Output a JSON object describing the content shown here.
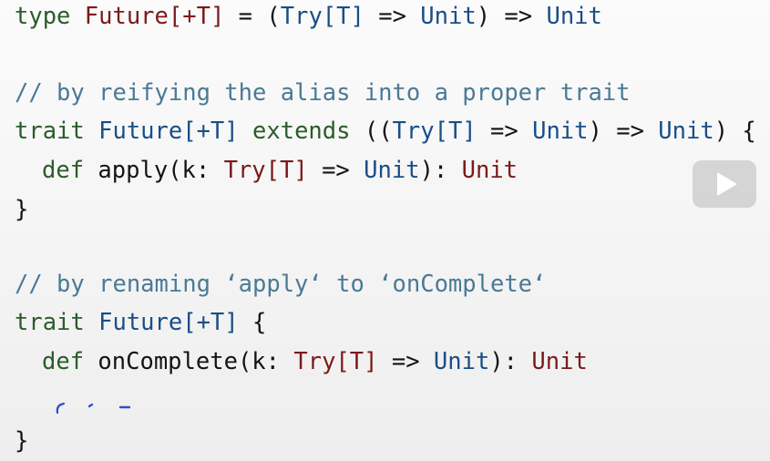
{
  "code": {
    "line1": {
      "kw": "type",
      "name": " Future[+T]",
      "eq": " = (",
      "t1": "Try[T]",
      "a1": " => ",
      "u1": "Unit",
      "close": ") => ",
      "u2": "Unit"
    },
    "line2": {
      "comment": "// by reifying the alias into a proper trait"
    },
    "line3": {
      "kw": "trait",
      "name": " Future[+T]",
      "ext": " extends",
      "open": " ((",
      "t1": "Try[T]",
      "a1": " => ",
      "u1": "Unit",
      "mid": ") => ",
      "u2": "Unit",
      "close": ") {"
    },
    "line4": {
      "kw": "def",
      "name": " apply(k: ",
      "t1": "Try[T]",
      "a1": " => ",
      "u1": "Unit",
      "colon": "): ",
      "ret": "Unit"
    },
    "line5": {
      "brace": "}"
    },
    "line6": {
      "comment": "// by renaming ‘apply‘ to ‘onComplete‘"
    },
    "line7": {
      "kw": "trait",
      "name": " Future[+T]",
      "open": " {"
    },
    "line8": {
      "kw": "def",
      "name": " onComplete(k: ",
      "t1": "Try[T]",
      "a1": " => ",
      "u1": "Unit",
      "colon": "): ",
      "ret": "Unit"
    },
    "line9": {
      "brace": "}"
    }
  },
  "icons": {
    "play": "play-icon"
  },
  "colors": {
    "keyword": "#2a5c2a",
    "type": "#7a1a1a",
    "unit": "#1a4e86",
    "comment": "#4a7a96",
    "scribble": "#2b4fd6"
  }
}
